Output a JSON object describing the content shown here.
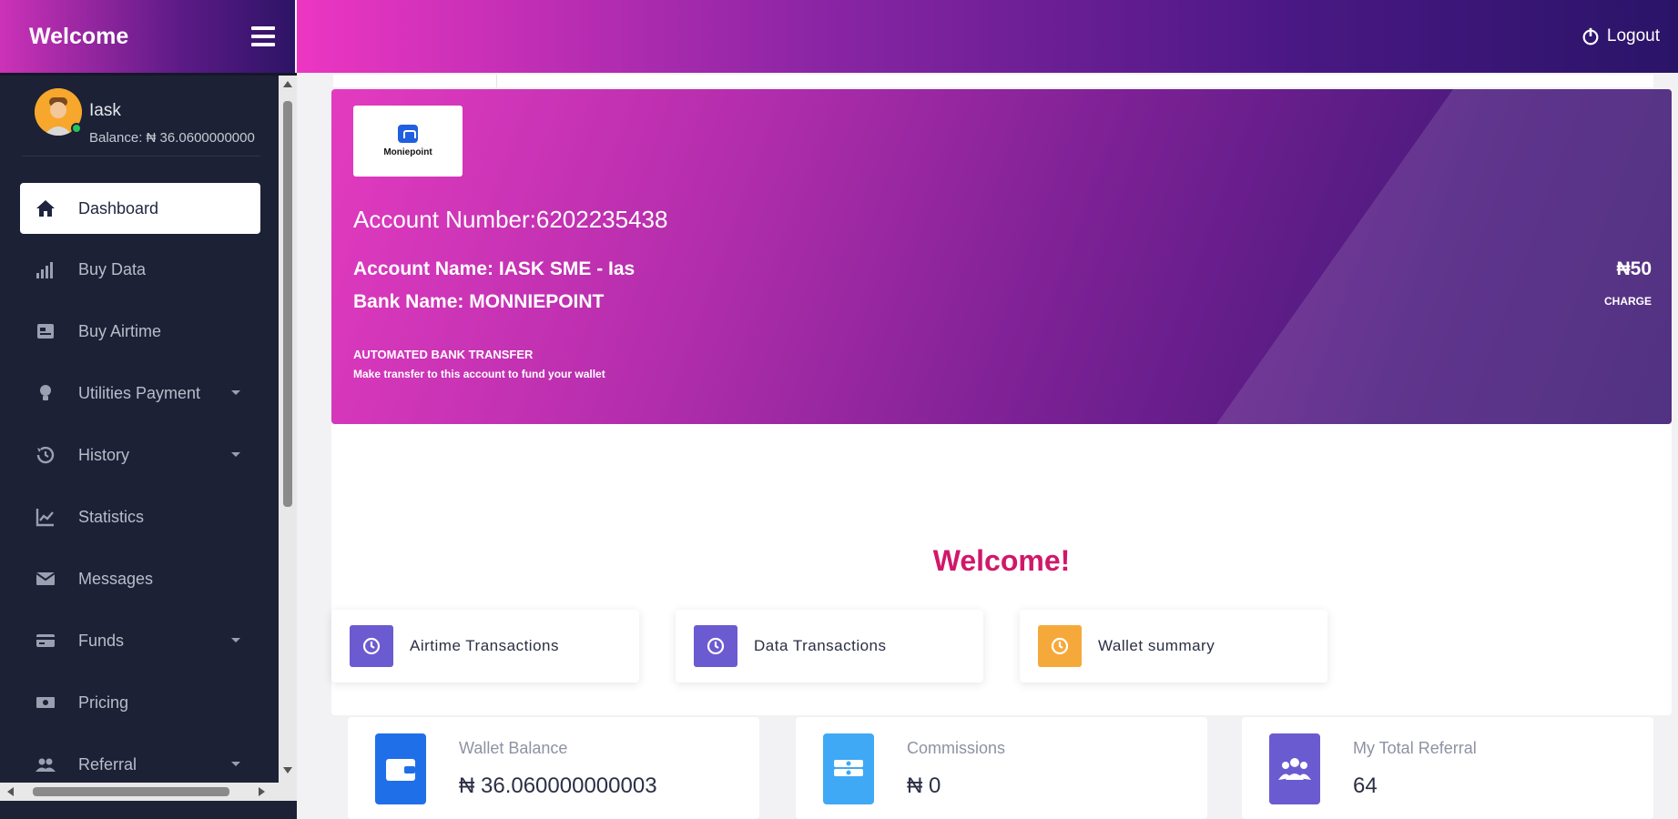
{
  "app": {
    "brand_title": "Welcome"
  },
  "header": {
    "logout_label": "Logout"
  },
  "user": {
    "name": "Iask",
    "balance": "Balance: ₦ 36.0600000000"
  },
  "sidebar": {
    "items": [
      {
        "label": "Dashboard",
        "icon": "home-icon",
        "active": true,
        "has_submenu": false
      },
      {
        "label": "Buy Data",
        "icon": "signal-bars-icon",
        "active": false,
        "has_submenu": false
      },
      {
        "label": "Buy Airtime",
        "icon": "phone-card-icon",
        "active": false,
        "has_submenu": false
      },
      {
        "label": "Utilities Payment",
        "icon": "lightbulb-icon",
        "active": false,
        "has_submenu": true
      },
      {
        "label": "History",
        "icon": "history-icon",
        "active": false,
        "has_submenu": true
      },
      {
        "label": "Statistics",
        "icon": "line-chart-icon",
        "active": false,
        "has_submenu": false
      },
      {
        "label": "Messages",
        "icon": "envelope-icon",
        "active": false,
        "has_submenu": false
      },
      {
        "label": "Funds",
        "icon": "credit-card-icon",
        "active": false,
        "has_submenu": true
      },
      {
        "label": "Pricing",
        "icon": "money-icon",
        "active": false,
        "has_submenu": false
      },
      {
        "label": "Referral",
        "icon": "users-icon",
        "active": false,
        "has_submenu": true
      }
    ]
  },
  "account_card": {
    "bank_logo_text": "Moniepoint",
    "account_number": "Account Number:6202235438",
    "account_name": "Account Name: IASK SME - Ias",
    "bank_name": "Bank Name: MONNIEPOINT",
    "transfer_title": "AUTOMATED BANK TRANSFER",
    "transfer_note": "Make transfer to this account to fund your wallet",
    "charge_amount": "₦50",
    "charge_label": "CHARGE"
  },
  "welcome": {
    "title": "Welcome!",
    "quick_links": [
      {
        "label": "Airtime Transactions",
        "icon": "receipt-icon",
        "color": "#6a5bd0"
      },
      {
        "label": "Data Transactions",
        "icon": "receipt-icon",
        "color": "#6a5bd0"
      },
      {
        "label": "Wallet summary",
        "icon": "receipt-icon",
        "color": "#f6a93b"
      }
    ]
  },
  "stats": [
    {
      "label": "Wallet Balance",
      "value": "₦ 36.060000000003",
      "icon": "wallet-icon",
      "color": "#1f6fe8"
    },
    {
      "label": "Commissions",
      "value": "₦ 0",
      "icon": "cash-stack-icon",
      "color": "#3fa9f5"
    },
    {
      "label": "My Total Referral",
      "value": "64",
      "icon": "users-group-icon",
      "color": "#6a5bd0"
    }
  ],
  "colors": {
    "sidebar_bg": "#1c2136",
    "welcome_title": "#d0186a",
    "gradient_pink": "#e43bc0",
    "gradient_purple": "#3a1670"
  }
}
